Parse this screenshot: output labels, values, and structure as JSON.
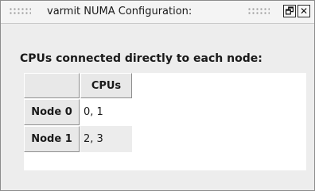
{
  "window": {
    "title": "varmit NUMA Configuration:",
    "restore_icon": "restore-icon",
    "close_icon": "close-icon",
    "restore_glyph": "🗗",
    "close_glyph": "✕"
  },
  "content": {
    "heading": "CPUs connected directly to each node:",
    "table": {
      "corner": "",
      "column_header": "CPUs",
      "rows": [
        {
          "node": "Node 0",
          "cpus": "0, 1"
        },
        {
          "node": "Node 1",
          "cpus": "2, 3"
        }
      ]
    }
  }
}
